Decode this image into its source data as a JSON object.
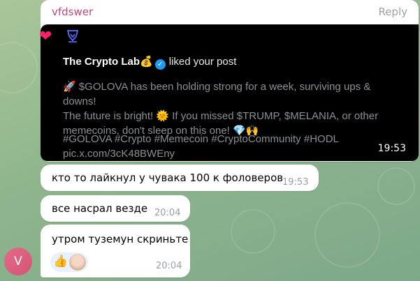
{
  "colors": {
    "sender": "#c2467a",
    "accent": "#1d9bf0",
    "heart": "#ff1f6b"
  },
  "header": {
    "sender": "vfdswer",
    "reply": "Reply"
  },
  "embed": {
    "icons": [
      "heart-icon",
      "bot-logo-icon"
    ],
    "account": "The Crypto Lab💰",
    "action": "liked your post",
    "post_line1": "🚀 $GOLOVA has been holding strong for a week, surviving ups & downs!",
    "post_line2": "The future is bright! 🌞 If you missed $TRUMP, $MELANIA, or other",
    "post_line3": "memecoins, don't sleep on this one! 💎🙌",
    "tags": "#GOLOVA #Crypto #Memecoin #CryptoCommunity #HODL",
    "link": "pic.x.com/3cK48BWEny",
    "time": "19:53"
  },
  "messages": [
    {
      "text": "кто то лайкнул у чувака 100 к фоловеров",
      "time": "19:53"
    },
    {
      "text": "все насрал везде",
      "time": "20:04"
    },
    {
      "text": "утром туземун скриньте",
      "time": "20:04",
      "reaction": "👍"
    }
  ],
  "avatar": {
    "initial": "V"
  }
}
